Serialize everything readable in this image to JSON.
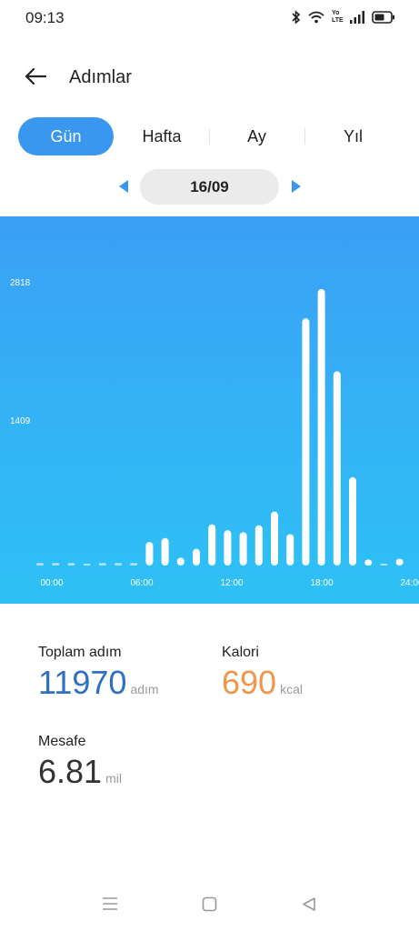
{
  "status": {
    "time": "09:13",
    "volte": "Yo LTE"
  },
  "header": {
    "title": "Adımlar"
  },
  "tabs": [
    {
      "label": "Gün",
      "active": true
    },
    {
      "label": "Hafta",
      "active": false
    },
    {
      "label": "Ay",
      "active": false
    },
    {
      "label": "Yıl",
      "active": false
    }
  ],
  "date_nav": {
    "current": "16/09"
  },
  "chart_data": {
    "type": "bar",
    "title": "",
    "xlabel": "",
    "ylabel": "",
    "x_ticks": [
      "00:00",
      "06:00",
      "12:00",
      "18:00",
      "24:00"
    ],
    "y_ticks": [
      1409,
      2818
    ],
    "ylim": [
      0,
      2818
    ],
    "categories": [
      "00",
      "01",
      "02",
      "03",
      "04",
      "05",
      "06",
      "07",
      "08",
      "09",
      "10",
      "11",
      "12",
      "13",
      "14",
      "15",
      "16",
      "17",
      "18",
      "19",
      "20",
      "21",
      "22",
      "23"
    ],
    "values": [
      25,
      25,
      25,
      5,
      25,
      25,
      25,
      240,
      280,
      80,
      170,
      420,
      360,
      340,
      410,
      550,
      320,
      2520,
      2818,
      1980,
      900,
      60,
      15,
      70
    ],
    "grid": false,
    "colors": {
      "bar": "#ffffff",
      "background": "#3aa6f5"
    }
  },
  "stats": {
    "steps": {
      "label": "Toplam adım",
      "value": "11970",
      "unit": "adım",
      "color": "#2f6fc4"
    },
    "calories": {
      "label": "Kalori",
      "value": "690",
      "unit": "kcal",
      "color": "#f0954a"
    },
    "distance": {
      "label": "Mesafe",
      "value": "6.81",
      "unit": "mil",
      "color": "#333333"
    }
  }
}
